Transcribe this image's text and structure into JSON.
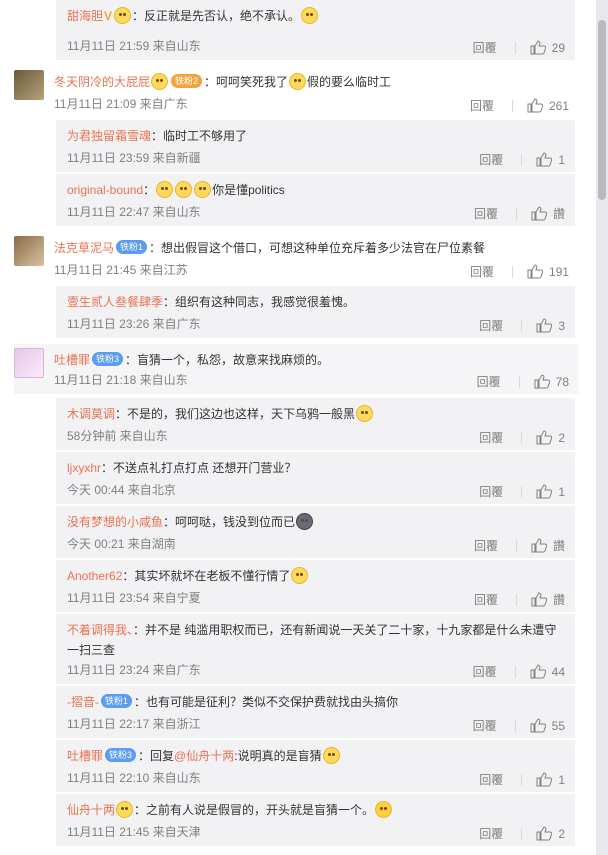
{
  "colors": {
    "name": "#eb7350",
    "meta": "#808080",
    "sub_bg": "#f2f2f5",
    "badge": "#5b9cf1"
  },
  "labels": {
    "reply": "回覆"
  },
  "comments": [
    {
      "kind": "sub",
      "name": "甜海胆",
      "text": "：反正就是先否认，绝不承认。",
      "time": "11月11日 21:59 来自山东",
      "likes": "29"
    },
    {
      "kind": "top",
      "name": "冬天阴冷的大屁屁",
      "badge": "铁粉2",
      "text": "：呵呵笑死我了",
      "text2": "假的要么临时工",
      "time": "11月11日 21:09 来自广东",
      "likes": "261"
    },
    {
      "kind": "sub",
      "name": "为君独留霜雪魂",
      "text": "：临时工不够用了",
      "time": "11月11日 23:59 来自新疆",
      "likes": "1"
    },
    {
      "kind": "sub",
      "name": "original-bound",
      "text": "：",
      "text2": "你是懂politics",
      "time": "11月11日 22:47 来自山东",
      "likes": "讚"
    },
    {
      "kind": "top",
      "name": "法克草泥马",
      "badge": "铁粉1",
      "text": "：想出假冒这个借口，可想这种单位充斥着多少法官在尸位素餐",
      "time": "11月11日 21:45 来自江苏",
      "likes": "191"
    },
    {
      "kind": "sub",
      "name": "壹生贰人叁餐肆季",
      "text": "：组织有这种同志，我感觉很羞愧。",
      "time": "11月11日 23:26 来自广东",
      "likes": "3"
    },
    {
      "kind": "top",
      "name": "吐槽罪",
      "badge": "铁粉3",
      "text": "：盲猜一个，私怨，故意来找麻烦的。",
      "time": "11月11日 21:18 来自山东",
      "likes": "78"
    },
    {
      "kind": "sub",
      "name": "木调莫调",
      "text": "：不是的，我们这边也这样，天下乌鸦一般黑",
      "time": "58分钟前 来自山东",
      "likes": "2"
    },
    {
      "kind": "sub",
      "name": "ljxyxhr",
      "text": "：不送点礼打点打点 还想开门营业？",
      "time": "今天 00:44 来自北京",
      "likes": "1"
    },
    {
      "kind": "sub",
      "name": "没有梦想的小咸鱼",
      "text": "：呵呵哒，钱没到位而已",
      "time": "今天 00:21 来自湖南",
      "likes": "讚"
    },
    {
      "kind": "sub",
      "name": "Another62",
      "text": "：其实坏就坏在老板不懂行情了",
      "time": "11月11日 23:54 来自宁夏",
      "likes": "讚"
    },
    {
      "kind": "sub2",
      "name": "不着调得我、",
      "text": "：并不是 纯滥用职权而已，还有新闻说一天关了二十家，十九家都是什么未遭守",
      "text_line2": "一扫三查",
      "time": "11月11日 23:24 来自广东",
      "likes": "44"
    },
    {
      "kind": "sub",
      "name": "-摺音-",
      "badge": "铁粉1",
      "text": "：也有可能是征利？类似不交保护费就找由头搞你",
      "time": "11月11日 22:17 来自浙江",
      "likes": "55"
    },
    {
      "kind": "sub",
      "name": "吐槽罪",
      "badge": "铁粉3",
      "text": "：回复",
      "at": "@仙舟十两",
      "text2": ":说明真的是盲猜",
      "time": "11月11日 22:10 来自山东",
      "likes": "1"
    },
    {
      "kind": "sub",
      "name": "仙舟十两",
      "text": "：之前有人说是假冒的，开头就是盲猜一个。",
      "time": "11月11日 21:45 来自天津",
      "likes": "2"
    }
  ]
}
